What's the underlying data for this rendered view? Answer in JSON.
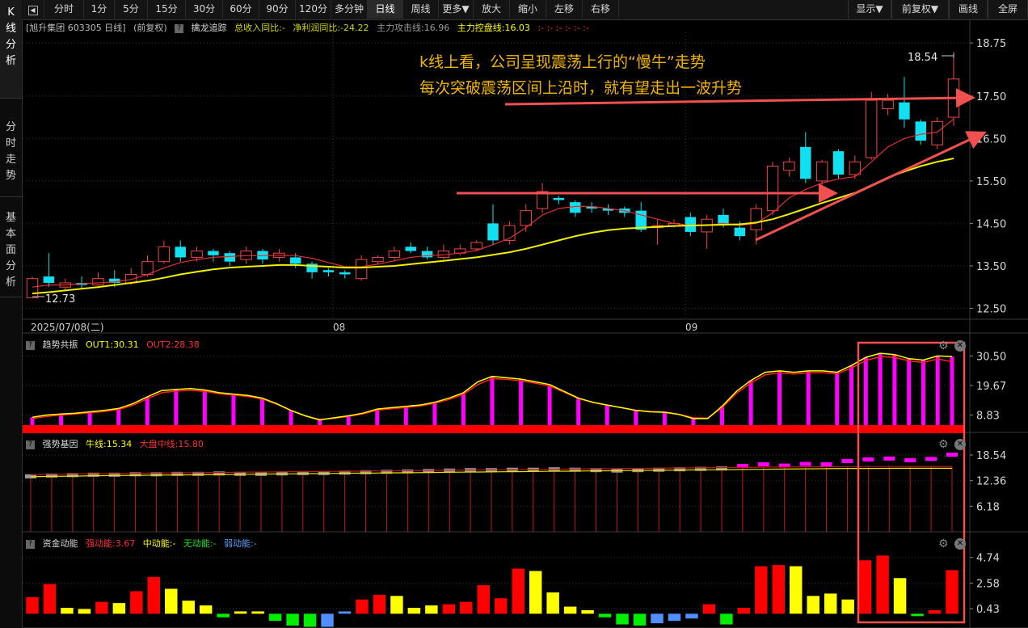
{
  "sidebar": {
    "tabs": [
      {
        "label": "K线分析",
        "chars": [
          "K",
          "线",
          "分",
          "析"
        ]
      },
      {
        "label": "分时走势",
        "chars": [
          "分",
          "时",
          "走",
          "势"
        ]
      },
      {
        "label": "基本面分析",
        "chars": [
          "基",
          "本",
          "面",
          "分",
          "析"
        ]
      }
    ]
  },
  "toolbar": {
    "back_icon": "back-icon",
    "periods": [
      "分时",
      "1分",
      "5分",
      "15分",
      "30分",
      "60分",
      "90分",
      "120分",
      "多分钟",
      "日线",
      "周线",
      "更多▼"
    ],
    "active_period": "日线",
    "actions": [
      "放大",
      "缩小",
      "左移",
      "右移"
    ],
    "right_menu": [
      "显示▼",
      "前复权▼",
      "画线",
      "全屏"
    ]
  },
  "main_panel": {
    "stock_label": "[旭升集团 603305 日线]",
    "adjust_label": "(前复权)",
    "indicator_name": "擒龙追踪",
    "metrics": [
      {
        "text": "总收入同比:-",
        "color": "#d6d600"
      },
      {
        "text": "净利润同比:-24.22",
        "color": "#d6d600"
      },
      {
        "text": "主力攻击线:16.96",
        "color": "#9a9a9a"
      },
      {
        "text": "主力控盘线:16.03",
        "color": "#ffff00"
      },
      {
        "text": ":- :- :- :- :- :-",
        "color": "#ff3030"
      }
    ],
    "annotation_line1": "k线上看，公司呈现震荡上行的“慢牛”走势",
    "annotation_line2": "每次突破震荡区间上沿时，就有望走出一波升势",
    "high_label": "18.54",
    "low_label": "12.73",
    "date_labels": [
      {
        "text": "2025/07/08(二)",
        "x": 38
      },
      {
        "text": "08",
        "x": 412
      },
      {
        "text": "09",
        "x": 848
      }
    ]
  },
  "panel_trend": {
    "name": "趋势共振",
    "out1": "OUT1:30.31",
    "out2": "OUT2:28.38"
  },
  "panel_strong": {
    "name": "强势基因",
    "bull": "牛线:15.34",
    "market": "大盘中线:15.80"
  },
  "panel_money": {
    "name": "资金动能",
    "strong": "强动能:3.67",
    "medium": "中动能:-",
    "none": "无动能:-",
    "weak": "弱动能:-"
  },
  "colors": {
    "up": "#f04848",
    "down": "#10e0f0",
    "ma_fast": "#e03030",
    "ma_slow": "#f0f000",
    "magenta": "#ff00ff",
    "highlight": "#f05050"
  },
  "chart_data": [
    {
      "type": "candlestick",
      "title": "旭升集团 603305 日线",
      "ylim": [
        12.3,
        19.0
      ],
      "y_ticks": [
        18.75,
        17.5,
        16.5,
        15.5,
        14.5,
        13.5,
        12.5
      ],
      "candles": [
        [
          12.75,
          13.2,
          13.25,
          12.73
        ],
        [
          13.25,
          13.1,
          13.8,
          13.0
        ],
        [
          13.0,
          13.1,
          13.2,
          12.9
        ],
        [
          13.1,
          13.05,
          13.25,
          12.95
        ],
        [
          13.05,
          13.2,
          13.35,
          13.0
        ],
        [
          13.2,
          13.1,
          13.4,
          13.0
        ],
        [
          13.1,
          13.3,
          13.45,
          13.05
        ],
        [
          13.3,
          13.6,
          13.75,
          13.25
        ],
        [
          13.6,
          13.95,
          14.1,
          13.55
        ],
        [
          13.95,
          13.7,
          14.1,
          13.6
        ],
        [
          13.7,
          13.85,
          13.95,
          13.6
        ],
        [
          13.85,
          13.75,
          13.9,
          13.6
        ],
        [
          13.8,
          13.6,
          13.85,
          13.5
        ],
        [
          13.65,
          13.85,
          13.95,
          13.55
        ],
        [
          13.85,
          13.65,
          13.9,
          13.55
        ],
        [
          13.7,
          13.8,
          13.9,
          13.6
        ],
        [
          13.7,
          13.55,
          13.8,
          13.45
        ],
        [
          13.55,
          13.35,
          13.6,
          13.2
        ],
        [
          13.4,
          13.35,
          13.45,
          13.25
        ],
        [
          13.35,
          13.3,
          13.4,
          13.2
        ],
        [
          13.2,
          13.65,
          13.75,
          13.15
        ],
        [
          13.6,
          13.7,
          13.75,
          13.55
        ],
        [
          13.7,
          13.85,
          13.95,
          13.6
        ],
        [
          13.95,
          13.85,
          14.05,
          13.8
        ],
        [
          13.85,
          13.7,
          13.95,
          13.65
        ],
        [
          13.7,
          13.85,
          14.0,
          13.65
        ],
        [
          13.8,
          13.9,
          14.0,
          13.75
        ],
        [
          13.9,
          14.05,
          14.1,
          13.85
        ],
        [
          14.5,
          14.1,
          14.95,
          14.0
        ],
        [
          14.1,
          14.45,
          14.55,
          14.0
        ],
        [
          14.45,
          14.8,
          14.95,
          14.3
        ],
        [
          14.85,
          15.25,
          15.45,
          14.75
        ],
        [
          15.1,
          15.05,
          15.15,
          14.95
        ],
        [
          15.0,
          14.75,
          15.05,
          14.65
        ],
        [
          14.9,
          14.85,
          15.0,
          14.75
        ],
        [
          14.85,
          14.8,
          14.95,
          14.7
        ],
        [
          14.85,
          14.75,
          14.9,
          14.65
        ],
        [
          14.8,
          14.35,
          15.0,
          14.3
        ],
        [
          14.4,
          14.45,
          14.6,
          14.0
        ],
        [
          14.45,
          14.5,
          14.6,
          14.4
        ],
        [
          14.65,
          14.3,
          14.75,
          14.2
        ],
        [
          14.3,
          14.6,
          14.7,
          13.9
        ],
        [
          14.7,
          14.5,
          14.85,
          14.4
        ],
        [
          14.4,
          14.2,
          14.55,
          14.1
        ],
        [
          14.35,
          14.85,
          14.95,
          14.0
        ],
        [
          14.8,
          15.85,
          15.95,
          14.7
        ],
        [
          15.75,
          15.95,
          16.05,
          15.6
        ],
        [
          16.3,
          15.55,
          16.65,
          15.45
        ],
        [
          15.5,
          15.95,
          16.0,
          15.4
        ],
        [
          16.2,
          15.65,
          16.25,
          15.55
        ],
        [
          15.65,
          15.95,
          16.1,
          15.55
        ],
        [
          16.05,
          17.4,
          17.6,
          16.0
        ],
        [
          17.2,
          17.4,
          17.55,
          17.05
        ],
        [
          17.35,
          16.95,
          17.95,
          16.75
        ],
        [
          16.9,
          16.45,
          16.95,
          16.35
        ],
        [
          16.35,
          16.9,
          17.0,
          16.25
        ],
        [
          17.0,
          17.9,
          18.54,
          16.8
        ]
      ],
      "ma_fast": [
        13.0,
        13.05,
        13.05,
        13.08,
        13.1,
        13.12,
        13.18,
        13.3,
        13.45,
        13.58,
        13.65,
        13.7,
        13.72,
        13.74,
        13.74,
        13.75,
        13.74,
        13.68,
        13.58,
        13.48,
        13.48,
        13.54,
        13.62,
        13.7,
        13.74,
        13.76,
        13.8,
        13.86,
        14.0,
        14.15,
        14.4,
        14.7,
        14.85,
        14.9,
        14.9,
        14.85,
        14.8,
        14.7,
        14.6,
        14.5,
        14.45,
        14.45,
        14.5,
        14.45,
        14.5,
        14.75,
        15.1,
        15.3,
        15.45,
        15.55,
        15.6,
        15.95,
        16.3,
        16.5,
        16.6,
        16.65,
        16.96
      ],
      "ma_slow": [
        12.85,
        12.88,
        12.92,
        12.96,
        13.0,
        13.05,
        13.1,
        13.15,
        13.22,
        13.3,
        13.36,
        13.42,
        13.46,
        13.48,
        13.5,
        13.52,
        13.52,
        13.5,
        13.48,
        13.46,
        13.46,
        13.48,
        13.5,
        13.54,
        13.58,
        13.62,
        13.66,
        13.7,
        13.76,
        13.82,
        13.9,
        14.0,
        14.1,
        14.2,
        14.28,
        14.34,
        14.38,
        14.4,
        14.42,
        14.44,
        14.45,
        14.46,
        14.47,
        14.48,
        14.52,
        14.6,
        14.72,
        14.85,
        14.98,
        15.1,
        15.22,
        15.4,
        15.58,
        15.72,
        15.85,
        15.95,
        16.03
      ]
    },
    {
      "type": "bar",
      "title": "趋势共振",
      "ylim": [
        4.5,
        33.0
      ],
      "y_ticks": [
        30.5,
        19.67,
        8.83
      ],
      "out1": [
        8.0,
        8.8,
        9.2,
        9.5,
        10.0,
        10.5,
        11.2,
        13.0,
        15.5,
        17.8,
        18.2,
        18.5,
        18.0,
        17.0,
        16.5,
        16.0,
        15.0,
        13.0,
        10.5,
        8.5,
        7.0,
        7.8,
        8.5,
        9.5,
        11.0,
        11.5,
        12.0,
        12.5,
        13.5,
        15.0,
        17.0,
        21.0,
        23.0,
        22.5,
        22.0,
        21.0,
        20.0,
        17.5,
        15.0,
        13.5,
        12.5,
        11.5,
        10.5,
        10.0,
        9.8,
        9.0,
        7.5,
        7.5,
        12.0,
        17.5,
        21.5,
        24.5,
        25.0,
        24.5,
        25.0,
        25.0,
        24.5,
        27.0,
        30.0,
        31.5,
        31.0,
        29.5,
        29.0,
        30.5,
        30.31
      ],
      "out2": [
        7.5,
        8.3,
        8.8,
        9.2,
        9.6,
        10.1,
        10.8,
        12.4,
        14.8,
        17.0,
        17.6,
        17.9,
        17.5,
        16.6,
        16.1,
        15.6,
        14.7,
        12.8,
        10.4,
        8.5,
        7.2,
        7.6,
        8.3,
        9.2,
        10.6,
        11.1,
        11.6,
        12.1,
        13.1,
        14.5,
        16.4,
        20.0,
        22.2,
        21.9,
        21.4,
        20.5,
        19.5,
        17.2,
        14.9,
        13.4,
        12.4,
        11.5,
        10.6,
        10.1,
        9.9,
        9.1,
        7.8,
        7.7,
        11.5,
        16.8,
        20.6,
        23.6,
        24.3,
        23.9,
        24.3,
        24.4,
        23.9,
        26.1,
        28.8,
        30.3,
        30.0,
        28.7,
        28.1,
        29.4,
        28.38
      ]
    },
    {
      "type": "bar",
      "title": "强势基因",
      "ylim": [
        0,
        20.5
      ],
      "y_ticks": [
        18.54,
        12.36,
        6.18
      ],
      "bull_line": [
        13.3,
        13.4,
        13.45,
        13.55,
        13.6,
        13.65,
        13.7,
        13.75,
        13.8,
        13.85,
        13.9,
        13.95,
        14.0,
        14.05,
        14.1,
        14.15,
        14.2,
        14.25,
        14.3,
        14.35,
        14.4,
        14.45,
        14.5,
        14.55,
        14.6,
        14.65,
        14.7,
        14.75,
        14.8,
        14.85,
        14.9,
        14.95,
        15.0,
        15.05,
        15.1,
        15.15,
        15.2,
        15.25,
        15.3,
        15.3,
        15.32,
        15.34,
        15.34,
        15.34
      ],
      "market_line": [
        13.8,
        13.9,
        14.0,
        14.05,
        14.1,
        14.15,
        14.2,
        14.25,
        14.3,
        14.35,
        14.4,
        14.45,
        14.5,
        14.55,
        14.6,
        14.65,
        14.7,
        14.75,
        14.8,
        14.85,
        14.9,
        14.95,
        15.0,
        15.05,
        15.1,
        15.15,
        15.2,
        15.25,
        15.3,
        15.35,
        15.4,
        15.45,
        15.5,
        15.55,
        15.6,
        15.65,
        15.7,
        15.72,
        15.75,
        15.76,
        15.78,
        15.79,
        15.8,
        15.8
      ],
      "blocks": [
        13.3,
        13.5,
        13.6,
        13.7,
        13.7,
        13.8,
        13.8,
        13.9,
        13.9,
        14.0,
        13.9,
        13.9,
        14.0,
        14.1,
        14.1,
        14.2,
        14.3,
        14.4,
        14.5,
        14.6,
        14.7,
        14.8,
        14.8,
        14.9,
        14.9,
        15.0,
        14.9,
        14.8,
        14.7,
        14.8,
        14.9,
        15.0,
        15.1,
        15.2,
        15.8,
        16.2,
        15.9,
        16.3,
        16.2,
        17.0,
        17.4,
        17.6,
        17.2,
        17.5,
        18.54
      ]
    },
    {
      "type": "bar",
      "title": "资金动能",
      "ylim": [
        -1.2,
        5.4
      ],
      "y_ticks": [
        4.74,
        2.58,
        0.43
      ],
      "bars": [
        [
          1.4,
          "r"
        ],
        [
          2.5,
          "r"
        ],
        [
          0.5,
          "y"
        ],
        [
          0.4,
          "y"
        ],
        [
          1.0,
          "r"
        ],
        [
          0.9,
          "y"
        ],
        [
          1.9,
          "r"
        ],
        [
          3.1,
          "r"
        ],
        [
          2.1,
          "y"
        ],
        [
          1.1,
          "y"
        ],
        [
          0.7,
          "y"
        ],
        [
          -0.3,
          "g"
        ],
        [
          0.2,
          "y"
        ],
        [
          0.2,
          "y"
        ],
        [
          -0.6,
          "g"
        ],
        [
          -1.0,
          "g"
        ],
        [
          -1.1,
          "g"
        ],
        [
          -1.1,
          "b"
        ],
        [
          0.2,
          "b"
        ],
        [
          1.2,
          "r"
        ],
        [
          1.6,
          "r"
        ],
        [
          1.5,
          "y"
        ],
        [
          0.5,
          "y"
        ],
        [
          0.7,
          "y"
        ],
        [
          0.8,
          "r"
        ],
        [
          1.0,
          "r"
        ],
        [
          2.4,
          "r"
        ],
        [
          1.3,
          "r"
        ],
        [
          3.8,
          "r"
        ],
        [
          3.6,
          "y"
        ],
        [
          1.8,
          "y"
        ],
        [
          0.6,
          "y"
        ],
        [
          0.3,
          "y"
        ],
        [
          -0.3,
          "g"
        ],
        [
          -0.9,
          "g"
        ],
        [
          -1.0,
          "g"
        ],
        [
          -0.8,
          "b"
        ],
        [
          -0.6,
          "b"
        ],
        [
          -0.4,
          "b"
        ],
        [
          0.8,
          "r"
        ],
        [
          -0.9,
          "g"
        ],
        [
          0.5,
          "r"
        ],
        [
          4.0,
          "r"
        ],
        [
          4.1,
          "r"
        ],
        [
          4.0,
          "y"
        ],
        [
          1.5,
          "y"
        ],
        [
          1.7,
          "y"
        ],
        [
          1.2,
          "y"
        ],
        [
          4.5,
          "r"
        ],
        [
          4.9,
          "r"
        ],
        [
          3.0,
          "y"
        ],
        [
          -0.2,
          "g"
        ],
        [
          0.3,
          "r"
        ],
        [
          3.67,
          "r"
        ]
      ]
    }
  ]
}
